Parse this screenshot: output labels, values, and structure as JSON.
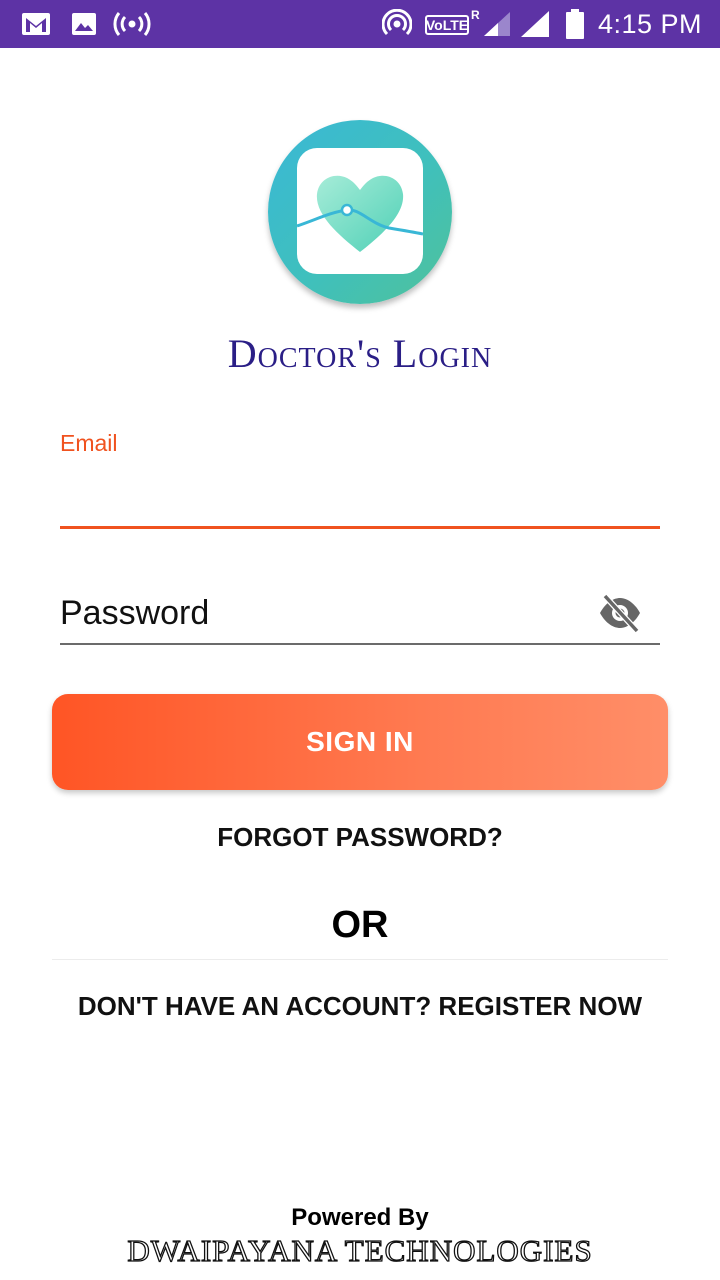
{
  "status_bar": {
    "time": "4:15 PM",
    "network_label": "VoLTE",
    "roaming_label": "R",
    "background_color": "#5d33a5",
    "icons": [
      "gmail-icon",
      "gallery-icon",
      "broadcast-icon",
      "hotspot-icon",
      "signal-icon",
      "signal-icon",
      "battery-icon"
    ]
  },
  "login": {
    "title": "Doctor's Login",
    "email_label": "Email",
    "email_value": "",
    "password_placeholder": "Password",
    "sign_in_label": "SIGN IN",
    "forgot_label": "FORGOT PASSWORD?",
    "or_label": "OR",
    "register_label": "DON'T HAVE AN ACCOUNT? REGISTER NOW"
  },
  "footer": {
    "powered_by": "Powered By",
    "company": "DWAIPAYANA TECHNOLOGIES"
  },
  "colors": {
    "accent": "#f0521f",
    "title": "#2a1e86",
    "button_start": "#ff5525",
    "button_end": "#ff8e68",
    "logo_teal": "#3fc0bc"
  }
}
